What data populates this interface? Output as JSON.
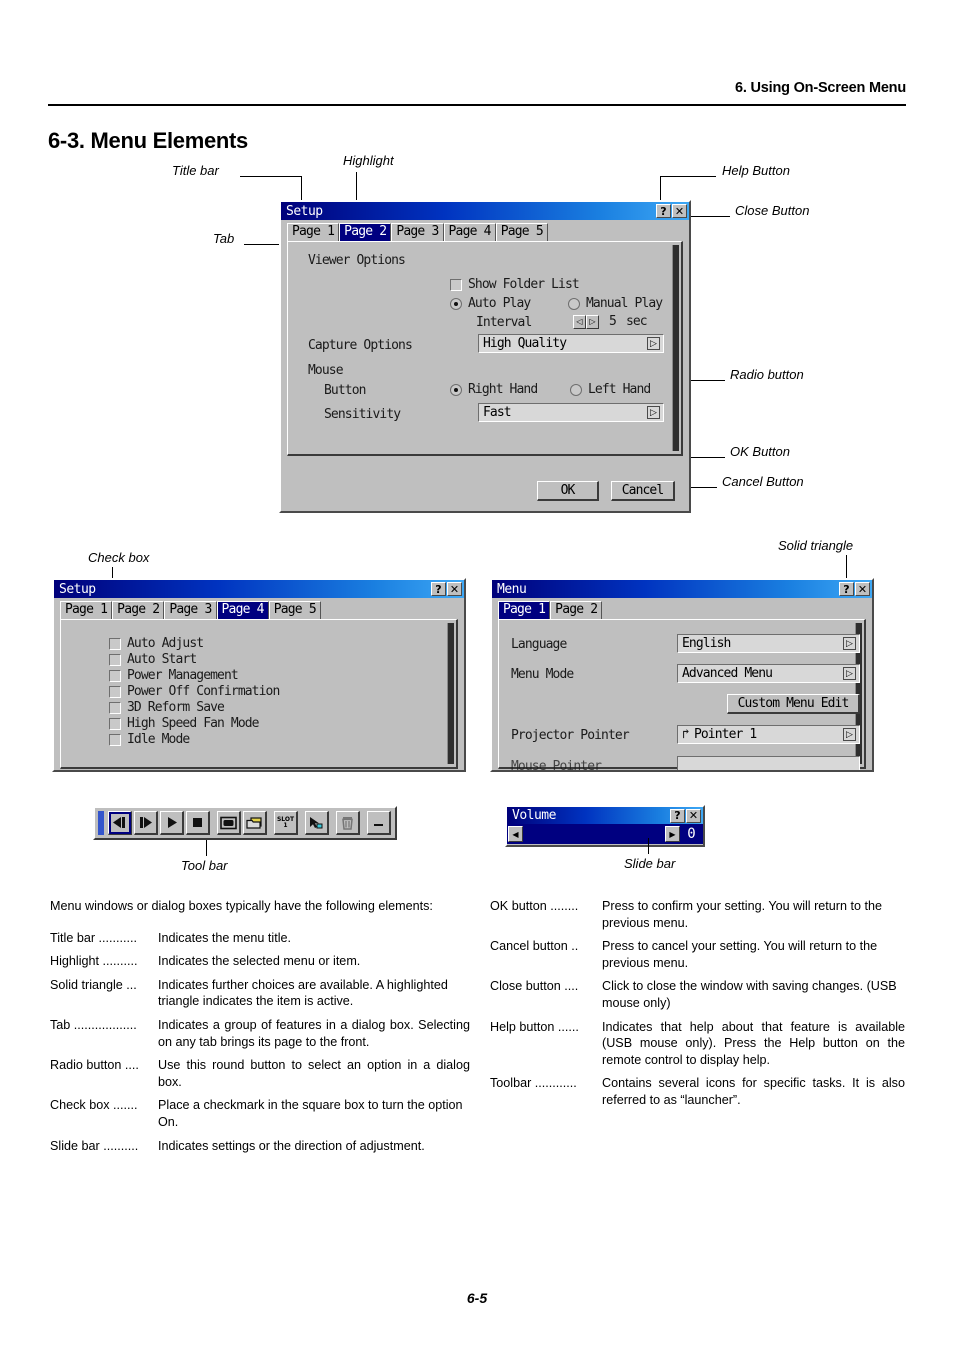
{
  "header": {
    "chapter_title": "6. Using On-Screen Menu",
    "section_title": "6-3. Menu Elements"
  },
  "footer": {
    "page_number": "6-5"
  },
  "callouts": {
    "title_bar": "Title bar",
    "highlight": "Highlight",
    "tab": "Tab",
    "help_button": "Help Button",
    "close_button": "Close Button",
    "radio_button": "Radio button",
    "ok_button": "OK Button",
    "cancel_button": "Cancel Button",
    "check_box": "Check box",
    "solid_triangle": "Solid triangle",
    "tool_bar": "Tool bar",
    "slide_bar": "Slide bar"
  },
  "setup_dialog": {
    "title": "Setup",
    "help_glyph": "?",
    "close_glyph": "✕",
    "tabs": [
      {
        "label": "Page 1",
        "selected": false
      },
      {
        "label": "Page 2",
        "selected": true
      },
      {
        "label": "Page 3",
        "selected": false
      },
      {
        "label": "Page 4",
        "selected": false
      },
      {
        "label": "Page 5",
        "selected": false
      }
    ],
    "viewer_options_label": "Viewer Options",
    "show_folder_list_label": "Show Folder List",
    "show_folder_list_checked": false,
    "auto_play_label": "Auto Play",
    "auto_play_selected": true,
    "manual_play_label": "Manual Play",
    "manual_play_selected": false,
    "interval_label": "Interval",
    "interval_dec_glyph": "◁",
    "interval_inc_glyph": "▷",
    "interval_value": "5",
    "interval_unit": "sec",
    "capture_options_label": "Capture Options",
    "capture_options_value": "High Quality",
    "mouse_label": "Mouse",
    "button_label": "Button",
    "right_hand_label": "Right Hand",
    "right_hand_selected": true,
    "left_hand_label": "Left Hand",
    "left_hand_selected": false,
    "sensitivity_label": "Sensitivity",
    "sensitivity_value": "Fast",
    "ok_label": "OK",
    "cancel_label": "Cancel",
    "dropdown_glyph": "▷"
  },
  "setup_page4_dialog": {
    "title": "Setup",
    "help_glyph": "?",
    "close_glyph": "✕",
    "tabs": [
      {
        "label": "Page 1",
        "selected": false
      },
      {
        "label": "Page 2",
        "selected": false
      },
      {
        "label": "Page 3",
        "selected": false
      },
      {
        "label": "Page 4",
        "selected": true
      },
      {
        "label": "Page 5",
        "selected": false
      }
    ],
    "checkboxes": [
      {
        "label": "Auto Adjust",
        "checked": false
      },
      {
        "label": "Auto Start",
        "checked": false
      },
      {
        "label": "Power Management",
        "checked": false
      },
      {
        "label": "Power Off Confirmation",
        "checked": false
      },
      {
        "label": "3D Reform Save",
        "checked": false
      },
      {
        "label": "High Speed Fan Mode",
        "checked": false
      },
      {
        "label": "Idle Mode",
        "checked": false
      }
    ]
  },
  "menu_dialog": {
    "title": "Menu",
    "help_glyph": "?",
    "close_glyph": "✕",
    "tabs": [
      {
        "label": "Page 1",
        "selected": true
      },
      {
        "label": "Page 2",
        "selected": false
      }
    ],
    "rows": [
      {
        "label": "Language",
        "value": "English"
      },
      {
        "label": "Menu Mode",
        "value": "Advanced Menu"
      }
    ],
    "custom_menu_edit_label": "Custom Menu Edit",
    "projector_pointer_label": "Projector Pointer",
    "projector_pointer_value": "Pointer 1",
    "pointer_glyph": "↱",
    "dropdown_glyph": "▷",
    "clipped_row_label": "Mouse Pointer"
  },
  "toolbar": {
    "buttons": [
      {
        "name": "play-previous",
        "glyph": "◀❙",
        "selected": true,
        "disabled": false
      },
      {
        "name": "play-next",
        "glyph": "❙▶",
        "selected": false,
        "disabled": false
      },
      {
        "name": "play",
        "glyph": "▶",
        "selected": false,
        "disabled": false
      },
      {
        "name": "stop",
        "glyph": "■",
        "selected": false,
        "disabled": false
      },
      {
        "name": "screen",
        "glyph": "▭",
        "selected": false,
        "disabled": false
      },
      {
        "name": "folder",
        "glyph": "❐",
        "selected": false,
        "disabled": false
      },
      {
        "name": "slot-1",
        "glyph": "SLOT 1",
        "selected": false,
        "disabled": false
      },
      {
        "name": "pointer-drag",
        "glyph": "➤",
        "selected": false,
        "disabled": false
      },
      {
        "name": "trash",
        "glyph": "Ὕ1",
        "selected": false,
        "disabled": true
      },
      {
        "name": "minimize",
        "glyph": "—",
        "selected": false,
        "disabled": false
      }
    ]
  },
  "volume_dialog": {
    "title": "Volume",
    "help_glyph": "?",
    "close_glyph": "✕",
    "left_glyph": "◀",
    "right_glyph": "▶",
    "value": "0"
  },
  "definitions": {
    "intro": "Menu windows or dialog boxes typically have the following elements:",
    "left": [
      {
        "term": "Title bar ...........",
        "desc": "Indicates the menu title."
      },
      {
        "term": "Highlight ..........",
        "desc": "Indicates the selected menu or item."
      },
      {
        "term": "Solid triangle ...",
        "desc": "Indicates further choices are available. A highlighted triangle indicates the item is active."
      },
      {
        "term": "Tab ..................",
        "desc": "Indicates a group of features in a dialog box. Selecting on any tab brings its page to the front."
      },
      {
        "term": "Radio button ....",
        "desc": "Use this round button to select an option in a dialog box."
      },
      {
        "term": "Check box .......",
        "desc": "Place a checkmark in the square box to turn the option On."
      },
      {
        "term": "Slide bar ..........",
        "desc": "Indicates settings or the direction of adjustment."
      }
    ],
    "right": [
      {
        "term": "OK button ........",
        "desc": "Press to confirm your setting. You will return to the previous menu."
      },
      {
        "term": "Cancel button ..",
        "desc": "Press to cancel your setting. You will return to the previous menu."
      },
      {
        "term": "Close button ....",
        "desc": "Click to close the window with saving changes. (USB mouse only)"
      },
      {
        "term": "Help button ......",
        "desc": "Indicates that help about that feature is available (USB mouse only). Press the Help button on the remote control to display help."
      },
      {
        "term": "Toolbar ............",
        "desc": "Contains several icons for specific tasks. It is also referred to as “launcher”."
      }
    ]
  }
}
